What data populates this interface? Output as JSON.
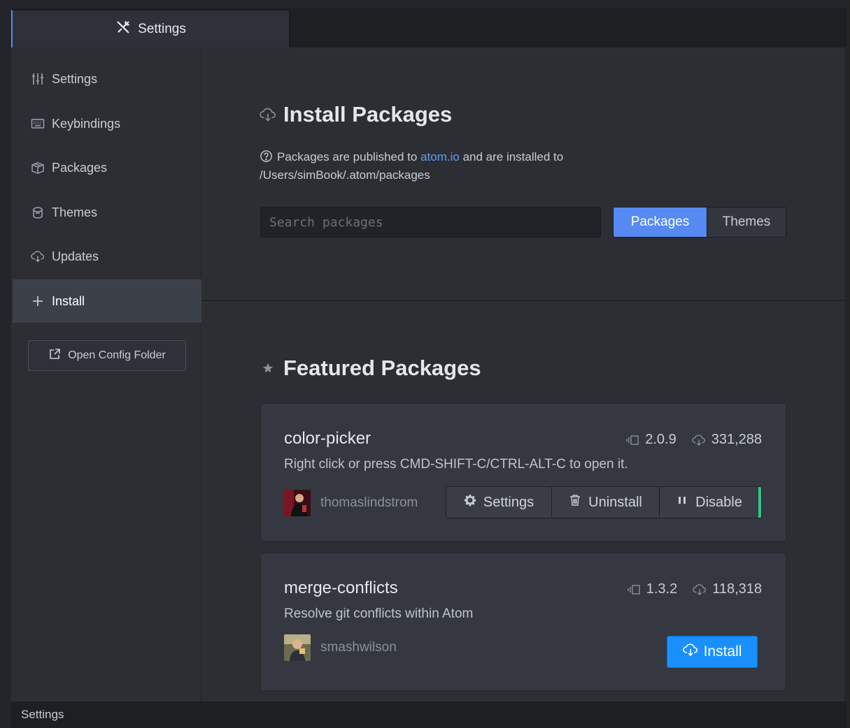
{
  "tab": {
    "title": "Settings",
    "icon": "tools-icon"
  },
  "sidebar": {
    "items": [
      {
        "label": "Settings",
        "icon": "sliders-icon"
      },
      {
        "label": "Keybindings",
        "icon": "keyboard-icon"
      },
      {
        "label": "Packages",
        "icon": "package-icon"
      },
      {
        "label": "Themes",
        "icon": "paintcan-icon"
      },
      {
        "label": "Updates",
        "icon": "cloud-download-icon"
      },
      {
        "label": "Install",
        "icon": "plus-icon"
      }
    ],
    "active": "Install",
    "open_config_label": "Open Config Folder"
  },
  "install": {
    "title": "Install Packages",
    "info_prefix": "Packages are published to ",
    "info_link": "atom.io",
    "info_suffix": " and are installed to",
    "info_path": "/Users/simBook/.atom/packages",
    "search_placeholder": "Search packages",
    "toggle": {
      "packages": "Packages",
      "themes": "Themes",
      "selected": "Packages"
    }
  },
  "featured": {
    "title": "Featured Packages",
    "packages": [
      {
        "name": "color-picker",
        "version": "2.0.9",
        "downloads": "331,288",
        "description": "Right click or press CMD-SHIFT-C/CTRL-ALT-C to open it.",
        "author": "thomaslindstrom",
        "installed": true,
        "actions": {
          "settings": "Settings",
          "uninstall": "Uninstall",
          "disable": "Disable"
        }
      },
      {
        "name": "merge-conflicts",
        "version": "1.3.2",
        "downloads": "118,318",
        "description": "Resolve git conflicts within Atom",
        "author": "smashwilson",
        "installed": false,
        "install_label": "Install"
      }
    ]
  },
  "statusbar": {
    "text": "Settings"
  },
  "colors": {
    "accent": "#568af2",
    "install": "#1a90ff",
    "enabled": "#2dc889"
  }
}
